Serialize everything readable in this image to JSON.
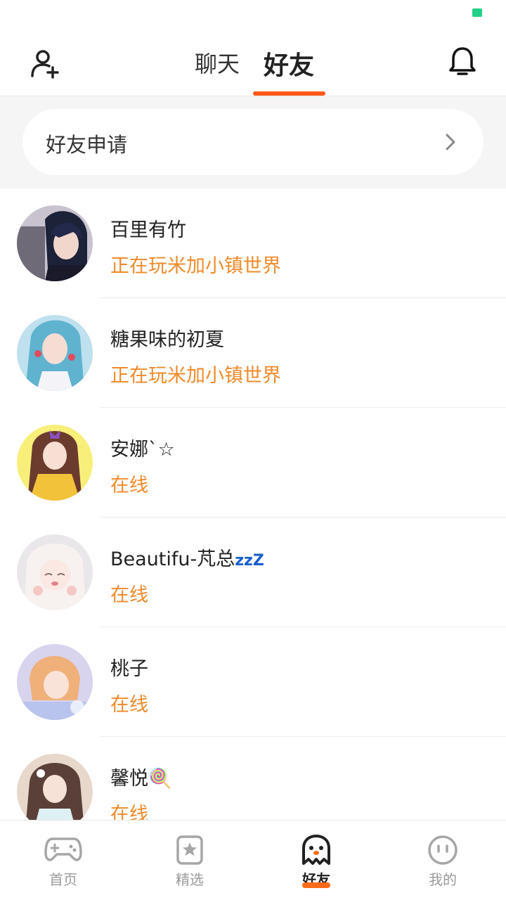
{
  "header": {
    "tabs": [
      {
        "label": "聊天",
        "active": false
      },
      {
        "label": "好友",
        "active": true
      }
    ],
    "accent_color": "#ff5a1a"
  },
  "friend_request": {
    "label": "好友申请"
  },
  "friends": [
    {
      "name": "百里有竹",
      "status": "正在玩米加小镇世界"
    },
    {
      "name": "糖果味的初夏",
      "status": "正在玩米加小镇世界"
    },
    {
      "name": "安娜`☆",
      "status": "在线"
    },
    {
      "name": "Beautifu-芃总",
      "name_suffix": "zzZ",
      "status": "在线"
    },
    {
      "name": "桃子",
      "status": "在线"
    },
    {
      "name": "馨悦🍭",
      "status": "在线"
    }
  ],
  "status_color": "#f08a2a",
  "bottom_nav": [
    {
      "label": "首页",
      "icon": "gamepad-icon",
      "active": false
    },
    {
      "label": "精选",
      "icon": "star-bookmark-icon",
      "active": false
    },
    {
      "label": "好友",
      "icon": "ghost-icon",
      "active": true
    },
    {
      "label": "我的",
      "icon": "face-icon",
      "active": false
    }
  ]
}
